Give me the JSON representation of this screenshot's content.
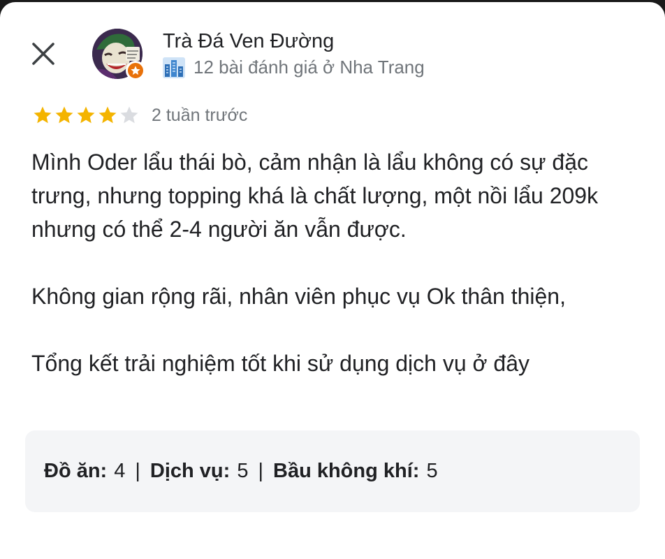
{
  "dialog": {
    "close_icon": "close-icon"
  },
  "reviewer": {
    "name": "Trà Đá Ven Đường",
    "avatar_icon": "joker-avatar",
    "badge_icon": "local-guide-star-icon",
    "badge_color": "#e8710a",
    "stats_icon": "city-buildings-icon",
    "stats_text": "12 bài đánh giá ở Nha Trang"
  },
  "review": {
    "rating": 4,
    "max_rating": 5,
    "star_color": "#f4b400",
    "empty_star_color": "#dadce0",
    "date": "2 tuần trước",
    "paragraph_1": "Mình Oder lẩu thái bò, cảm nhận là lẩu không có sự đặc trưng, nhưng topping khá là chất lượng, một nồi lẩu 209k nhưng có thể 2-4 người ăn vẫn được.",
    "paragraph_2": "Không gian rộng rãi, nhân viên phục vụ Ok thân thiện,",
    "paragraph_3": "Tổng kết trải nghiệm tốt khi sử dụng dịch vụ ở đây"
  },
  "attributes": {
    "separator": "|",
    "items": [
      {
        "label": "Đồ ăn:",
        "value": "4"
      },
      {
        "label": "Dịch vụ:",
        "value": "5"
      },
      {
        "label": "Bầu không khí:",
        "value": "5"
      }
    ]
  }
}
